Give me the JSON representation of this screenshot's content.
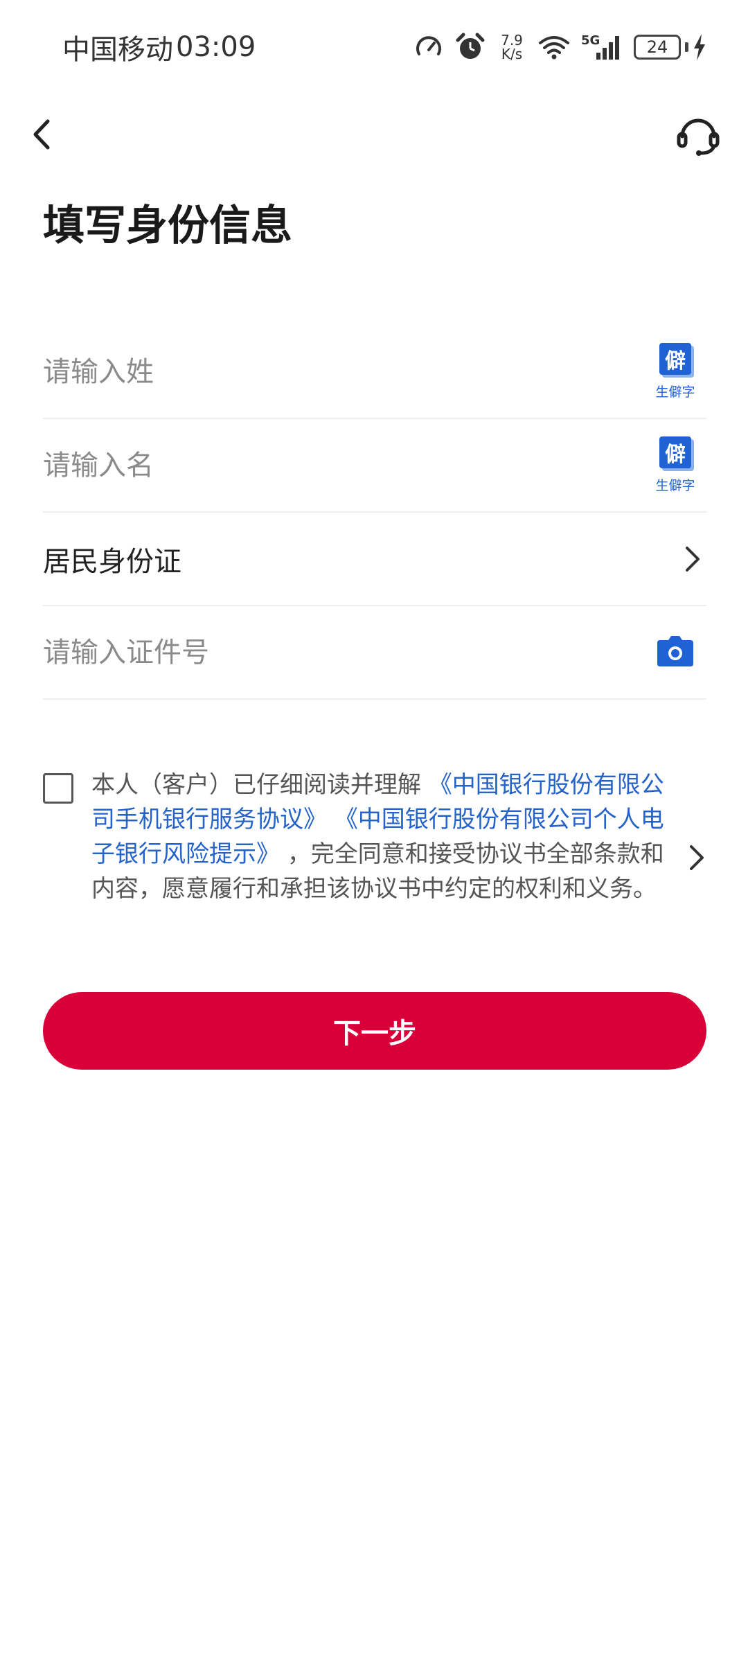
{
  "status_bar": {
    "carrier": "中国移动",
    "time": "03:09",
    "net_speed_value": "7.9",
    "net_speed_unit": "K/s",
    "network_type": "5G",
    "battery_level": "24"
  },
  "nav": {
    "back_icon": "chevron-left-icon",
    "support_icon": "headset-icon"
  },
  "page": {
    "title": "填写身份信息"
  },
  "form": {
    "surname_placeholder": "请输入姓",
    "given_name_placeholder": "请输入名",
    "rare_char_glyph": "僻",
    "rare_char_label": "生僻字",
    "id_type_value": "居民身份证",
    "id_number_placeholder": "请输入证件号"
  },
  "agreement": {
    "text_prefix": "本人（客户）已仔细阅读并理解",
    "link1": "《中国银行股份有限公司手机银行服务协议》",
    "link2": "《中国银行股份有限公司个人电子银行风险提示》",
    "text_suffix": "，完全同意和接受协议书全部条款和内容，愿意履行和承担该协议书中约定的权利和义务。",
    "checked": false
  },
  "actions": {
    "next_label": "下一步"
  },
  "colors": {
    "primary_red": "#d9003a",
    "link_blue": "#2563c9",
    "icon_blue": "#1f62d6"
  }
}
